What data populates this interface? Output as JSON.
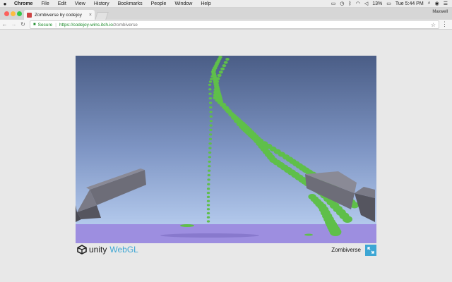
{
  "menubar": {
    "app_name": "Chrome",
    "items": [
      "File",
      "Edit",
      "View",
      "History",
      "Bookmarks",
      "People",
      "Window",
      "Help"
    ],
    "battery": "13%",
    "clock": "Tue 5:44 PM"
  },
  "tab": {
    "title": "Zombiverse by codejoy",
    "close_glyph": "×"
  },
  "profile": {
    "name": "Maxwell"
  },
  "address_bar": {
    "secure_label": "Secure",
    "url_host": "https://codejoy-wins.itch.io",
    "url_path": "/zombiverse"
  },
  "footer": {
    "unity_word": "unity",
    "webgl_word": "WebGL",
    "game_title": "Zombiverse"
  },
  "icons": {
    "apple": "apple-icon",
    "back": "back-arrow-icon",
    "forward": "forward-arrow-icon",
    "reload": "reload-icon",
    "lock": "lock-icon",
    "star": "star-icon",
    "menu": "three-dots-icon",
    "fullscreen": "fullscreen-icon"
  },
  "colors": {
    "sky_top": "#4a5d86",
    "sky_bottom": "#b3c9ec",
    "floor": "#9d8ee0",
    "zombie_green": "#5fbf4a",
    "gun_gray": "#6d6d78",
    "unity_blue": "#3da6d4",
    "secure_green": "#1b8a2a"
  }
}
